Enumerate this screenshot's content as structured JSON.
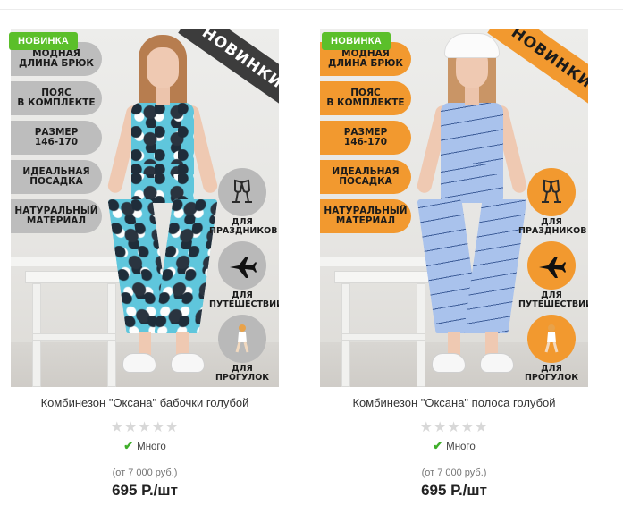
{
  "products": [
    {
      "badge": "НОВИНКА",
      "corner_tag": "НОВИНКИ",
      "features": [
        "МОДНАЯ\nДЛИНА БРЮК",
        "ПОЯС\nВ КОМПЛЕКТЕ",
        "РАЗМЕР\n146-170",
        "ИДЕАЛЬНАЯ\nПОСАДКА",
        "НАТУРАЛЬНЫЙ\nМАТЕРИАЛ"
      ],
      "uses": [
        "ДЛЯ\nПРАЗДНИКОВ",
        "ДЛЯ\nПУТЕШЕСТВИЙ",
        "ДЛЯ\nПРОГУЛОК"
      ],
      "title": "Комбинезон \"Оксана\" бабочки голубой",
      "stars": "★★★★★",
      "stock": "Много",
      "wholesale": "(от 7 000 руб.)",
      "price": "695 Р./шт",
      "accent_color": "#bdbdbd"
    },
    {
      "badge": "НОВИНКА",
      "corner_tag": "НОВИНКИ",
      "features": [
        "МОДНАЯ\nДЛИНА БРЮК",
        "ПОЯС\nВ КОМПЛЕКТЕ",
        "РАЗМЕР\n146-170",
        "ИДЕАЛЬНАЯ\nПОСАДКА",
        "НАТУРАЛЬНЫЙ\nМАТЕРИАЛ"
      ],
      "uses": [
        "ДЛЯ\nПРАЗДНИКОВ",
        "ДЛЯ\nПУТЕШЕСТВИЙ",
        "ДЛЯ\nПРОГУЛОК"
      ],
      "title": "Комбинезон \"Оксана\" полоса голубой",
      "stars": "★★★★★",
      "stock": "Много",
      "wholesale": "(от 7 000 руб.)",
      "price": "695 Р./шт",
      "accent_color": "#f2992f"
    }
  ],
  "icons": {
    "badge_color": "#5bbf2a",
    "check_color": "#3fae2a",
    "use_icons": [
      "champagne-glasses-icon",
      "airplane-icon",
      "walking-person-icon"
    ]
  }
}
